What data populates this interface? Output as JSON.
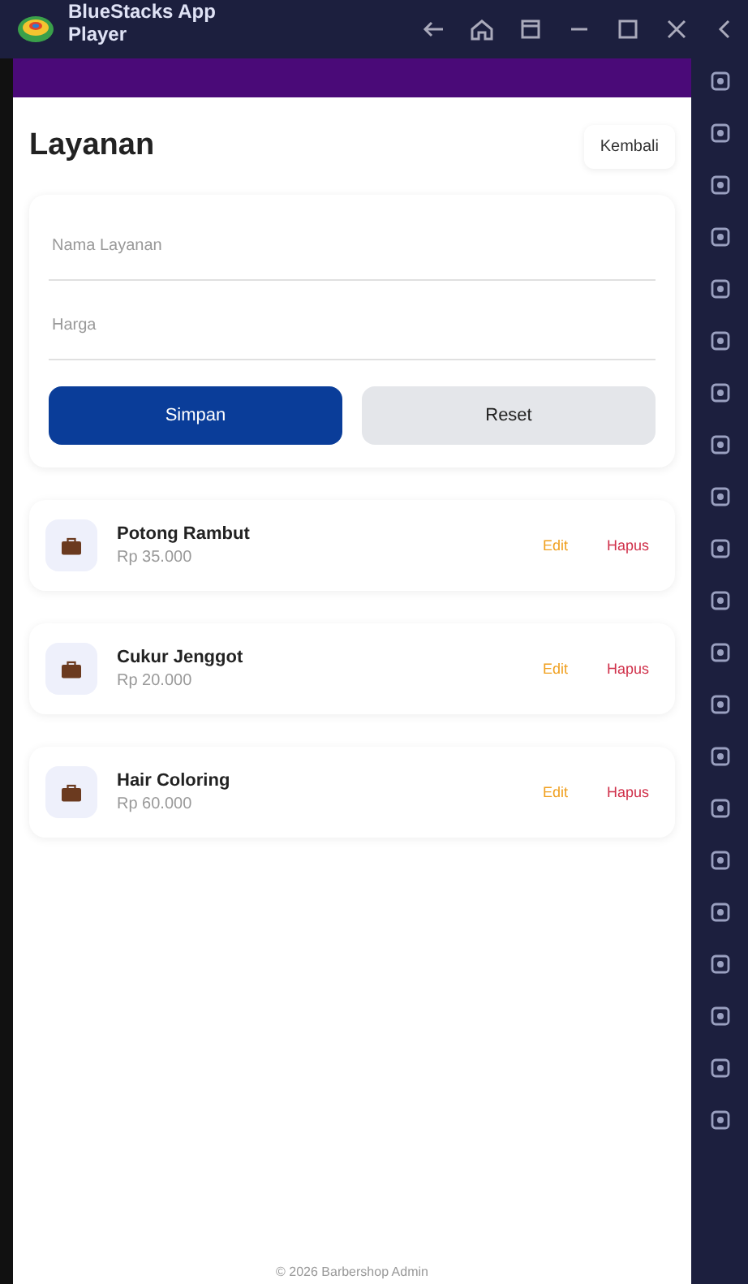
{
  "window": {
    "title": "BlueStacks App Player"
  },
  "page": {
    "title": "Layanan",
    "back_button": "Kembali"
  },
  "form": {
    "fields": [
      {
        "placeholder": "Nama Layanan"
      },
      {
        "placeholder": "Harga"
      }
    ],
    "buttons": [
      {
        "label": "Simpan",
        "kind": "primary"
      },
      {
        "label": "Reset",
        "kind": "secondary"
      }
    ]
  },
  "services": [
    {
      "name": "Potong Rambut",
      "price": "Rp 35.000",
      "edit": "Edit",
      "delete": "Hapus"
    },
    {
      "name": "Cukur Jenggot",
      "price": "Rp 20.000",
      "edit": "Edit",
      "delete": "Hapus"
    },
    {
      "name": "Hair Coloring",
      "price": "Rp 60.000",
      "edit": "Edit",
      "delete": "Hapus"
    }
  ],
  "footer": "© 2026 Barbershop Admin"
}
